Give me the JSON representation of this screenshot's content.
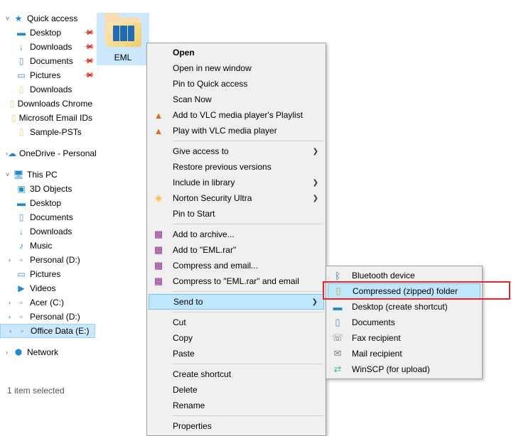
{
  "sidebar": {
    "items": [
      {
        "label": "Quick access",
        "icon": "★",
        "chev": "˅",
        "cls": "ic-star"
      },
      {
        "label": "Desktop",
        "icon": "▬",
        "pin": true,
        "cls": "ic-blue",
        "indent": true
      },
      {
        "label": "Downloads",
        "icon": "↓",
        "pin": true,
        "cls": "ic-blue",
        "indent": true
      },
      {
        "label": "Documents",
        "icon": "▯",
        "pin": true,
        "cls": "ic-doc",
        "indent": true
      },
      {
        "label": "Pictures",
        "icon": "▭",
        "pin": true,
        "cls": "ic-blue",
        "indent": true
      },
      {
        "label": "Downloads",
        "icon": "▯",
        "cls": "ic-folder",
        "indent": true
      },
      {
        "label": "Downloads Chrome",
        "icon": "▯",
        "cls": "ic-folder",
        "indent": true
      },
      {
        "label": "Microsoft Email IDs",
        "icon": "▯",
        "cls": "ic-folder",
        "indent": true
      },
      {
        "label": "Sample-PSTs",
        "icon": "▯",
        "cls": "ic-folder",
        "indent": true
      }
    ],
    "group2": [
      {
        "label": "OneDrive - Personal",
        "icon": "☁",
        "chev": "›",
        "cls": "ic-blue"
      }
    ],
    "group3": [
      {
        "label": "This PC",
        "icon": "🖥",
        "chev": "˅",
        "cls": "ic-blue"
      },
      {
        "label": "3D Objects",
        "icon": "▣",
        "cls": "ic-blue",
        "indent": true
      },
      {
        "label": "Desktop",
        "icon": "▬",
        "cls": "ic-blue",
        "indent": true
      },
      {
        "label": "Documents",
        "icon": "▯",
        "cls": "ic-doc",
        "indent": true
      },
      {
        "label": "Downloads",
        "icon": "↓",
        "cls": "ic-blue",
        "indent": true
      },
      {
        "label": "Music",
        "icon": "♪",
        "cls": "ic-music",
        "indent": true
      },
      {
        "label": "Personal (D:)",
        "icon": "▫",
        "chev": "›",
        "cls": "ic-drive",
        "indent": true
      },
      {
        "label": "Pictures",
        "icon": "▭",
        "cls": "ic-blue",
        "indent": true
      },
      {
        "label": "Videos",
        "icon": "▶",
        "cls": "ic-blue",
        "indent": true
      },
      {
        "label": "Acer (C:)",
        "icon": "▫",
        "chev": "›",
        "cls": "ic-drive",
        "indent": true
      },
      {
        "label": "Personal (D:)",
        "icon": "▫",
        "chev": "›",
        "cls": "ic-drive",
        "indent": true
      },
      {
        "label": "Office Data (E:)",
        "icon": "▫",
        "chev": "›",
        "cls": "ic-drive",
        "indent": true,
        "selected": true
      }
    ],
    "group4": [
      {
        "label": "Network",
        "icon": "⬢",
        "chev": "›",
        "cls": "ic-net"
      }
    ]
  },
  "content": {
    "folder_name": "EML"
  },
  "menu1": [
    {
      "type": "item",
      "label": "Open",
      "bold": true
    },
    {
      "type": "item",
      "label": "Open in new window"
    },
    {
      "type": "item",
      "label": "Pin to Quick access"
    },
    {
      "type": "item",
      "label": "Scan Now"
    },
    {
      "type": "item",
      "label": "Add to VLC media player's Playlist",
      "icon": "▲",
      "iconColor": "#e66a1f"
    },
    {
      "type": "item",
      "label": "Play with VLC media player",
      "icon": "▲",
      "iconColor": "#e66a1f"
    },
    {
      "type": "sep"
    },
    {
      "type": "item",
      "label": "Give access to",
      "arrow": true
    },
    {
      "type": "item",
      "label": "Restore previous versions"
    },
    {
      "type": "item",
      "label": "Include in library",
      "arrow": true
    },
    {
      "type": "item",
      "label": "Norton Security Ultra",
      "icon": "◈",
      "iconColor": "#f7c02a",
      "arrow": true
    },
    {
      "type": "item",
      "label": "Pin to Start"
    },
    {
      "type": "sep"
    },
    {
      "type": "item",
      "label": "Add to archive...",
      "icon": "▦",
      "iconColor": "#8b2b8b"
    },
    {
      "type": "item",
      "label": "Add to \"EML.rar\"",
      "icon": "▦",
      "iconColor": "#8b2b8b"
    },
    {
      "type": "item",
      "label": "Compress and email...",
      "icon": "▦",
      "iconColor": "#8b2b8b"
    },
    {
      "type": "item",
      "label": "Compress to \"EML.rar\" and email",
      "icon": "▦",
      "iconColor": "#8b2b8b"
    },
    {
      "type": "sep"
    },
    {
      "type": "item",
      "label": "Send to",
      "arrow": true,
      "hovered": true
    },
    {
      "type": "sep"
    },
    {
      "type": "item",
      "label": "Cut"
    },
    {
      "type": "item",
      "label": "Copy"
    },
    {
      "type": "item",
      "label": "Paste"
    },
    {
      "type": "sep"
    },
    {
      "type": "item",
      "label": "Create shortcut"
    },
    {
      "type": "item",
      "label": "Delete"
    },
    {
      "type": "item",
      "label": "Rename"
    },
    {
      "type": "sep"
    },
    {
      "type": "item",
      "label": "Properties"
    }
  ],
  "menu2": [
    {
      "label": "Bluetooth device",
      "icon": "ᛒ",
      "iconColor": "#2067b2"
    },
    {
      "label": "Compressed (zipped) folder",
      "icon": "▯",
      "iconColor": "#d9a62e",
      "hovered": true
    },
    {
      "label": "Desktop (create shortcut)",
      "icon": "▬",
      "iconColor": "#2089d6"
    },
    {
      "label": "Documents",
      "icon": "▯",
      "iconColor": "#5b8db9"
    },
    {
      "label": "Fax recipient",
      "icon": "☏",
      "iconColor": "#777"
    },
    {
      "label": "Mail recipient",
      "icon": "✉",
      "iconColor": "#777"
    },
    {
      "label": "WinSCP (for upload)",
      "icon": "⇄",
      "iconColor": "#4b8"
    }
  ],
  "status": "1 item selected"
}
